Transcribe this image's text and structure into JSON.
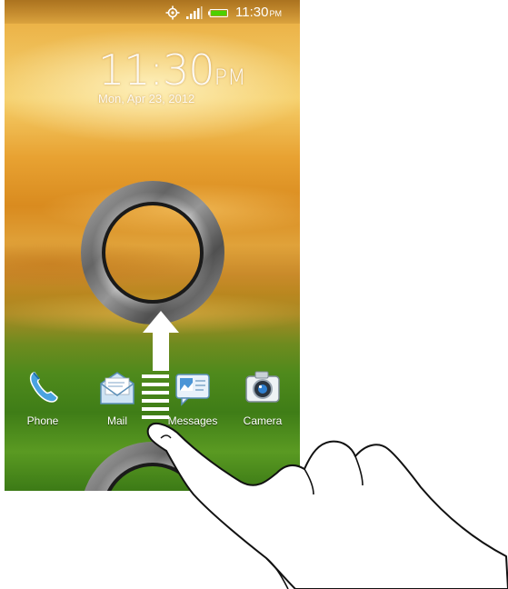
{
  "status_bar": {
    "time": "11:30",
    "time_ampm": "PM",
    "icons": [
      "gps-icon",
      "signal-icon",
      "battery-icon"
    ]
  },
  "lock_screen": {
    "clock_time": "11:30",
    "clock_ampm": "PM",
    "date": "Mon, Apr 23, 2012"
  },
  "dock": {
    "items": [
      {
        "label": "Phone",
        "icon": "phone-icon"
      },
      {
        "label": "Mail",
        "icon": "mail-icon"
      },
      {
        "label": "Messages",
        "icon": "messages-icon"
      },
      {
        "label": "Camera",
        "icon": "camera-icon"
      }
    ]
  },
  "gesture": {
    "direction": "up",
    "illustration": "hand-icon"
  },
  "colors": {
    "status_text": "#ffffff",
    "ring_inner": "#1a1a1a",
    "battery_green": "#4cd000"
  }
}
